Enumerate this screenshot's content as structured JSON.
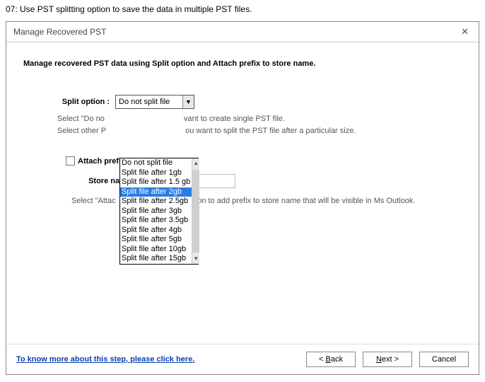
{
  "step_header": "07:  Use PST splitting option to save the data in multiple PST files.",
  "dialog": {
    "title": "Manage Recovered PST",
    "heading": "Manage recovered PST data using Split option and Attach prefix to store name.",
    "split_label": "Split option :",
    "split_selected": "Do not split file",
    "split_options": [
      "Do not split file",
      "Split file after 1gb",
      "Split file after 1.5 gb",
      "Split file after 2gb",
      "Split file after 2.5gb",
      "Split file after 3gb",
      "Split file after 3.5gb",
      "Split file after 4gb",
      "Split file after 5gb",
      "Split file after 10gb",
      "Split file after 15gb"
    ],
    "split_highlight_index": 3,
    "hint_line1_a": "Select \"Do no",
    "hint_line1_b": "vant to create single PST file.",
    "hint_line2_a": "Select other P",
    "hint_line2_b": "ou want to split the PST file after a particular size.",
    "attach_label": "Attach prefix t",
    "storename_label": "Store name",
    "hint2_a": "Select \"Attac",
    "hint2_b": "ption to add prefix to store name that will be visible in Ms Outlook.",
    "help_link": "To know more about this step, please click here.",
    "back_btn": "< Back",
    "next_btn": "Next >",
    "cancel_btn": "Cancel"
  }
}
